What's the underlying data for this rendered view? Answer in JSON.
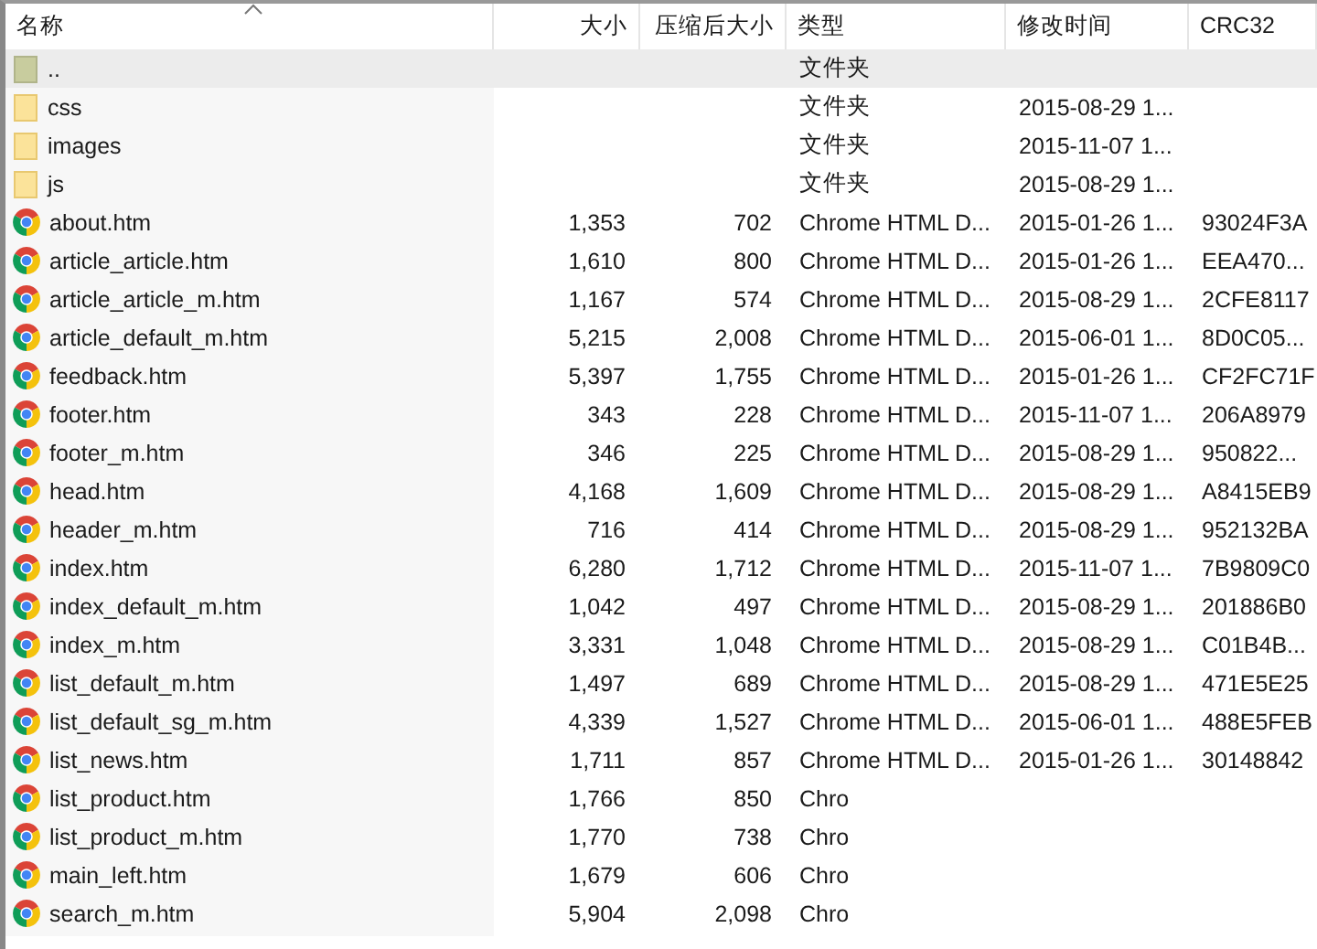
{
  "columns": [
    {
      "label": "名称",
      "sorted": true
    },
    {
      "label": "大小",
      "sorted": false
    },
    {
      "label": "压缩后大小",
      "sorted": false
    },
    {
      "label": "类型",
      "sorted": false
    },
    {
      "label": "修改时间",
      "sorted": false
    },
    {
      "label": "CRC32",
      "sorted": false
    }
  ],
  "rows": [
    {
      "kind": "up",
      "name": "..",
      "type": "文件夹",
      "selected": true
    },
    {
      "kind": "folder",
      "name": "css",
      "type": "文件夹",
      "modified": "2015-08-29 1...",
      "selected": false
    },
    {
      "kind": "folder",
      "name": "images",
      "type": "文件夹",
      "modified": "2015-11-07 1...",
      "selected": false
    },
    {
      "kind": "folder",
      "name": "js",
      "type": "文件夹",
      "modified": "2015-08-29 1...",
      "selected": false
    },
    {
      "kind": "file",
      "name": "about.htm",
      "size": "1,353",
      "packed": "702",
      "type": "Chrome HTML D...",
      "modified": "2015-01-26 1...",
      "crc": "93024F3A",
      "selected": false
    },
    {
      "kind": "file",
      "name": "article_article.htm",
      "size": "1,610",
      "packed": "800",
      "type": "Chrome HTML D...",
      "modified": "2015-01-26 1...",
      "crc": "EEA470...",
      "selected": false
    },
    {
      "kind": "file",
      "name": "article_article_m.htm",
      "size": "1,167",
      "packed": "574",
      "type": "Chrome HTML D...",
      "modified": "2015-08-29 1...",
      "crc": "2CFE8117",
      "selected": false
    },
    {
      "kind": "file",
      "name": "article_default_m.htm",
      "size": "5,215",
      "packed": "2,008",
      "type": "Chrome HTML D...",
      "modified": "2015-06-01 1...",
      "crc": "8D0C05...",
      "selected": false
    },
    {
      "kind": "file",
      "name": "feedback.htm",
      "size": "5,397",
      "packed": "1,755",
      "type": "Chrome HTML D...",
      "modified": "2015-01-26 1...",
      "crc": "CF2FC71F",
      "selected": false
    },
    {
      "kind": "file",
      "name": "footer.htm",
      "size": "343",
      "packed": "228",
      "type": "Chrome HTML D...",
      "modified": "2015-11-07 1...",
      "crc": "206A8979",
      "selected": false
    },
    {
      "kind": "file",
      "name": "footer_m.htm",
      "size": "346",
      "packed": "225",
      "type": "Chrome HTML D...",
      "modified": "2015-08-29 1...",
      "crc": "950822...",
      "selected": false
    },
    {
      "kind": "file",
      "name": "head.htm",
      "size": "4,168",
      "packed": "1,609",
      "type": "Chrome HTML D...",
      "modified": "2015-08-29 1...",
      "crc": "A8415EB9",
      "selected": false
    },
    {
      "kind": "file",
      "name": "header_m.htm",
      "size": "716",
      "packed": "414",
      "type": "Chrome HTML D...",
      "modified": "2015-08-29 1...",
      "crc": "952132BA",
      "selected": false
    },
    {
      "kind": "file",
      "name": "index.htm",
      "size": "6,280",
      "packed": "1,712",
      "type": "Chrome HTML D...",
      "modified": "2015-11-07 1...",
      "crc": "7B9809C0",
      "selected": false
    },
    {
      "kind": "file",
      "name": "index_default_m.htm",
      "size": "1,042",
      "packed": "497",
      "type": "Chrome HTML D...",
      "modified": "2015-08-29 1...",
      "crc": "201886B0",
      "selected": false
    },
    {
      "kind": "file",
      "name": "index_m.htm",
      "size": "3,331",
      "packed": "1,048",
      "type": "Chrome HTML D...",
      "modified": "2015-08-29 1...",
      "crc": "C01B4B...",
      "selected": false
    },
    {
      "kind": "file",
      "name": "list_default_m.htm",
      "size": "1,497",
      "packed": "689",
      "type": "Chrome HTML D...",
      "modified": "2015-08-29 1...",
      "crc": "471E5E25",
      "selected": false
    },
    {
      "kind": "file",
      "name": "list_default_sg_m.htm",
      "size": "4,339",
      "packed": "1,527",
      "type": "Chrome HTML D...",
      "modified": "2015-06-01 1...",
      "crc": "488E5FEB",
      "selected": false
    },
    {
      "kind": "file",
      "name": "list_news.htm",
      "size": "1,711",
      "packed": "857",
      "type": "Chrome HTML D...",
      "modified": "2015-01-26 1...",
      "crc": "30148842",
      "selected": false
    },
    {
      "kind": "file",
      "name": "list_product.htm",
      "size": "1,766",
      "packed": "850",
      "type": "Chro",
      "selected": false
    },
    {
      "kind": "file",
      "name": "list_product_m.htm",
      "size": "1,770",
      "packed": "738",
      "type": "Chro",
      "selected": false
    },
    {
      "kind": "file",
      "name": "main_left.htm",
      "size": "1,679",
      "packed": "606",
      "type": "Chro",
      "selected": false
    },
    {
      "kind": "file",
      "name": "search_m.htm",
      "size": "5,904",
      "packed": "2,098",
      "type": "Chro",
      "selected": false
    }
  ]
}
